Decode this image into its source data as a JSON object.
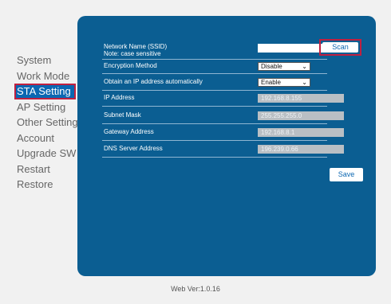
{
  "sidebar": {
    "items": [
      {
        "label": "System"
      },
      {
        "label": "Work Mode"
      },
      {
        "label": "STA Setting"
      },
      {
        "label": "AP Setting"
      },
      {
        "label": "Other Setting"
      },
      {
        "label": "Account"
      },
      {
        "label": "Upgrade SW"
      },
      {
        "label": "Restart"
      },
      {
        "label": "Restore"
      }
    ],
    "active": "STA Setting"
  },
  "form": {
    "network_name_label": "Network Name (SSID)",
    "network_name_note": "Note: case sensitive",
    "network_name_value": "",
    "scan_label": "Scan",
    "encryption_label": "Encryption Method",
    "encryption_value": "Disable",
    "dhcp_label": "Obtain an IP address automatically",
    "dhcp_value": "Enable",
    "ip_label": "IP Address",
    "ip_value": "192.168.8.155",
    "subnet_label": "Subnet Mask",
    "subnet_value": "255.255.255.0",
    "gateway_label": "Gateway Address",
    "gateway_value": "192.168.8.1",
    "dns_label": "DNS Server Address",
    "dns_value": "196.239.0.66",
    "save_label": "Save"
  },
  "footer": {
    "version": "Web Ver:1.0.16"
  },
  "colors": {
    "panel": "#0b5e92",
    "active_nav": "#0b67b2",
    "highlight_border": "#c02040",
    "disabled_field": "#b9bfc4"
  }
}
